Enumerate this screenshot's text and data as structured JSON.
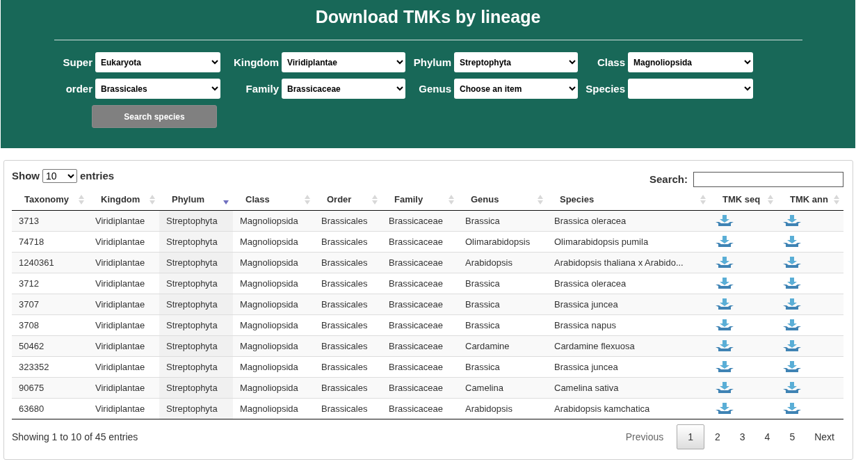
{
  "header": {
    "title": "Download TMKs by lineage",
    "filters": [
      {
        "label": "Super",
        "value": "Eukaryota"
      },
      {
        "label": "Kingdom",
        "value": "Viridiplantae"
      },
      {
        "label": "Phylum",
        "value": "Streptophyta"
      },
      {
        "label": "Class",
        "value": "Magnoliopsida"
      },
      {
        "label": "order",
        "value": "Brassicales"
      },
      {
        "label": "Family",
        "value": "Brassicaceae"
      },
      {
        "label": "Genus",
        "value": "Choose an item"
      },
      {
        "label": "Species"
      }
    ],
    "search_button": "Search species"
  },
  "table": {
    "length": {
      "before": "Show",
      "value": "10",
      "after": "entries"
    },
    "search_label": "Search:",
    "columns": [
      {
        "label": "Taxonomy",
        "sorted": false
      },
      {
        "label": "Kingdom",
        "sorted": false
      },
      {
        "label": "Phylum",
        "sorted": true
      },
      {
        "label": "Class",
        "sorted": false
      },
      {
        "label": "Order",
        "sorted": false
      },
      {
        "label": "Family",
        "sorted": false
      },
      {
        "label": "Genus",
        "sorted": false
      },
      {
        "label": "Species",
        "sorted": false
      },
      {
        "label": "TMK seq",
        "sorted": false
      },
      {
        "label": "TMK ann",
        "sorted": false
      }
    ],
    "rows": [
      [
        "3713",
        "Viridiplantae",
        "Streptophyta",
        "Magnoliopsida",
        "Brassicales",
        "Brassicaceae",
        "Brassica",
        "Brassica oleracea"
      ],
      [
        "74718",
        "Viridiplantae",
        "Streptophyta",
        "Magnoliopsida",
        "Brassicales",
        "Brassicaceae",
        "Olimarabidopsis",
        "Olimarabidopsis pumila"
      ],
      [
        "1240361",
        "Viridiplantae",
        "Streptophyta",
        "Magnoliopsida",
        "Brassicales",
        "Brassicaceae",
        "Arabidopsis",
        "Arabidopsis thaliana x Arabido..."
      ],
      [
        "3712",
        "Viridiplantae",
        "Streptophyta",
        "Magnoliopsida",
        "Brassicales",
        "Brassicaceae",
        "Brassica",
        "Brassica oleracea"
      ],
      [
        "3707",
        "Viridiplantae",
        "Streptophyta",
        "Magnoliopsida",
        "Brassicales",
        "Brassicaceae",
        "Brassica",
        "Brassica juncea"
      ],
      [
        "3708",
        "Viridiplantae",
        "Streptophyta",
        "Magnoliopsida",
        "Brassicales",
        "Brassicaceae",
        "Brassica",
        "Brassica napus"
      ],
      [
        "50462",
        "Viridiplantae",
        "Streptophyta",
        "Magnoliopsida",
        "Brassicales",
        "Brassicaceae",
        "Cardamine",
        "Cardamine flexuosa"
      ],
      [
        "323352",
        "Viridiplantae",
        "Streptophyta",
        "Magnoliopsida",
        "Brassicales",
        "Brassicaceae",
        "Brassica",
        "Brassica juncea"
      ],
      [
        "90675",
        "Viridiplantae",
        "Streptophyta",
        "Magnoliopsida",
        "Brassicales",
        "Brassicaceae",
        "Camelina",
        "Camelina sativa"
      ],
      [
        "63680",
        "Viridiplantae",
        "Streptophyta",
        "Magnoliopsida",
        "Brassicales",
        "Brassicaceae",
        "Arabidopsis",
        "Arabidopsis kamchatica"
      ]
    ],
    "info": "Showing 1 to 10 of 45 entries",
    "pagination": {
      "previous": "Previous",
      "pages": [
        {
          "label": "1",
          "selected": true
        },
        {
          "label": "2",
          "selected": false
        },
        {
          "label": "3",
          "selected": false
        },
        {
          "label": "4",
          "selected": false
        },
        {
          "label": "5",
          "selected": false
        }
      ],
      "next": "Next"
    }
  }
}
